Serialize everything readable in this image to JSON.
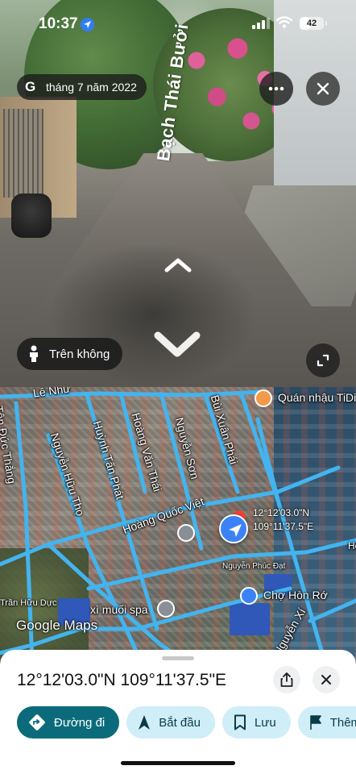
{
  "status_bar": {
    "time": "10:37",
    "battery": "42",
    "battery_level": 0.42
  },
  "street_view": {
    "capture_date": "tháng 7 năm 2022",
    "street_name": "Bạch Thái Bưởi",
    "aerial_button_label": "Trên không",
    "icons": {
      "google": "google-g-icon",
      "more": "more-horizontal-icon",
      "close": "close-icon",
      "expand": "expand-icon",
      "forward": "chevron-up-icon",
      "backward": "chevron-down-icon",
      "person": "person-icon"
    }
  },
  "map": {
    "streets": [
      "Lê Như",
      "Tôn Đức Thắng",
      "Nguyễn Hữu Thọ",
      "Huỳnh Tấn Phát",
      "Hoàng Văn Thái",
      "Nguyễn Sơn",
      "Bùi Xuân Phái",
      "Hoàng Quốc Việt",
      "Nguyễn Xí",
      "Trần Hữu Dực"
    ],
    "pois": {
      "restaurant": "Quán nhậu TiDi",
      "land_office": "Nguyễn Phúc Đạt",
      "market": "Chợ Hòn Rớ",
      "spa": "xì muối spa",
      "hon_ro": "Hòn Rớ"
    },
    "pin_coords": {
      "lat": "12°12'03.0\"N",
      "lng": "109°11'37.5\"E"
    },
    "attribution": "Google Maps",
    "colors": {
      "road": "#43b4ef",
      "location_pin": "#3b82f6",
      "marker": "#ea4335"
    }
  },
  "sheet": {
    "coordinates": "12°12'03.0\"N 109°11'37.5\"E",
    "actions": {
      "directions": "Đường đi",
      "start": "Bắt đầu",
      "save": "Lưu",
      "add": "Thêm"
    },
    "icons": {
      "share": "share-icon",
      "close": "close-icon",
      "directions": "directions-icon",
      "start": "navigation-arrow-icon",
      "save": "bookmark-icon",
      "add": "flag-icon"
    },
    "colors": {
      "primary_chip": "#0b6b7a",
      "secondary_chip": "#cfeef7"
    }
  }
}
